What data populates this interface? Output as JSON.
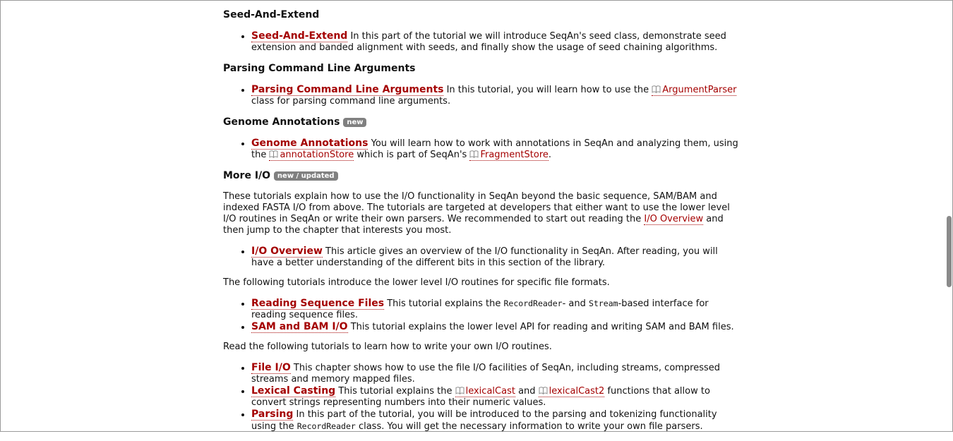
{
  "sections": {
    "seed": {
      "title": "Seed-And-Extend",
      "item_link": "Seed-And-Extend",
      "item_text": " In this part of the tutorial we will introduce SeqAn's seed class, demonstrate seed extension and banded alignment with seeds, and finally show the usage of seed chaining algorithms."
    },
    "args": {
      "title": "Parsing Command Line Arguments",
      "item_link": "Parsing Command Line Arguments",
      "item_text_1": " In this tutorial, you will learn how to use the ",
      "item_ref": "ArgumentParser",
      "item_text_2": " class for parsing command line arguments."
    },
    "genome": {
      "title": "Genome Annotations",
      "badge": "new",
      "item_link": "Genome Annotations",
      "item_text_1": " You will learn how to work with annotations in SeqAn and analyzing them, using the ",
      "item_ref_1": "annotationStore",
      "item_text_2": " which is part of SeqAn's ",
      "item_ref_2": "FragmentStore",
      "item_text_3": "."
    },
    "io": {
      "title": "More I/O",
      "badge": "new / updated",
      "intro_1": "These tutorials explain how to use the I/O functionality in SeqAn beyond the basic sequence, SAM/BAM and indexed FASTA I/O from above. The tutorials are targeted at developers that either want to use the lower level I/O routines in SeqAn or write their own parsers. We recommended to start out reading the ",
      "intro_link": "I/O Overview",
      "intro_2": " and then jump to the chapter that interests you most.",
      "overview_link": "I/O Overview",
      "overview_text": " This article gives an overview of the I/O functionality in SeqAn. After reading, you will have a better understanding of the different bits in this section of the library.",
      "lower_intro": "The following tutorials introduce the lower level I/O routines for specific file formats.",
      "reading_link": "Reading Sequence Files",
      "reading_text_1": " This tutorial explains the ",
      "reading_code_1": "RecordReader",
      "reading_text_2": "- and ",
      "reading_code_2": "Stream",
      "reading_text_3": "-based interface for reading sequence files.",
      "sam_link": "SAM and BAM I/O",
      "sam_text": " This tutorial explains the lower level API for reading and writing SAM and BAM files.",
      "own_intro": "Read the following tutorials to learn how to write your own I/O routines.",
      "file_link": "File I/O",
      "file_text": " This chapter shows how to use the file I/O facilities of SeqAn, including streams, compressed streams and memory mapped files.",
      "lexical_link": "Lexical Casting",
      "lexical_text_1": " This tutorial explains the ",
      "lexical_ref_1": "lexicalCast",
      "lexical_text_2": " and ",
      "lexical_ref_2": "lexicalCast2",
      "lexical_text_3": " functions that allow to convert strings representing numbers into their numeric values.",
      "parsing_link": "Parsing",
      "parsing_text_1": " In this part of the tutorial, you will be introduced to the parsing and tokenizing functionality using the ",
      "parsing_code": "RecordReader",
      "parsing_text_2": " class. You will get the necessary information to write your own file parsers."
    }
  },
  "colors": {
    "link": "#a40000",
    "badge": "#808080"
  },
  "icons": {
    "reference": "book-icon"
  }
}
